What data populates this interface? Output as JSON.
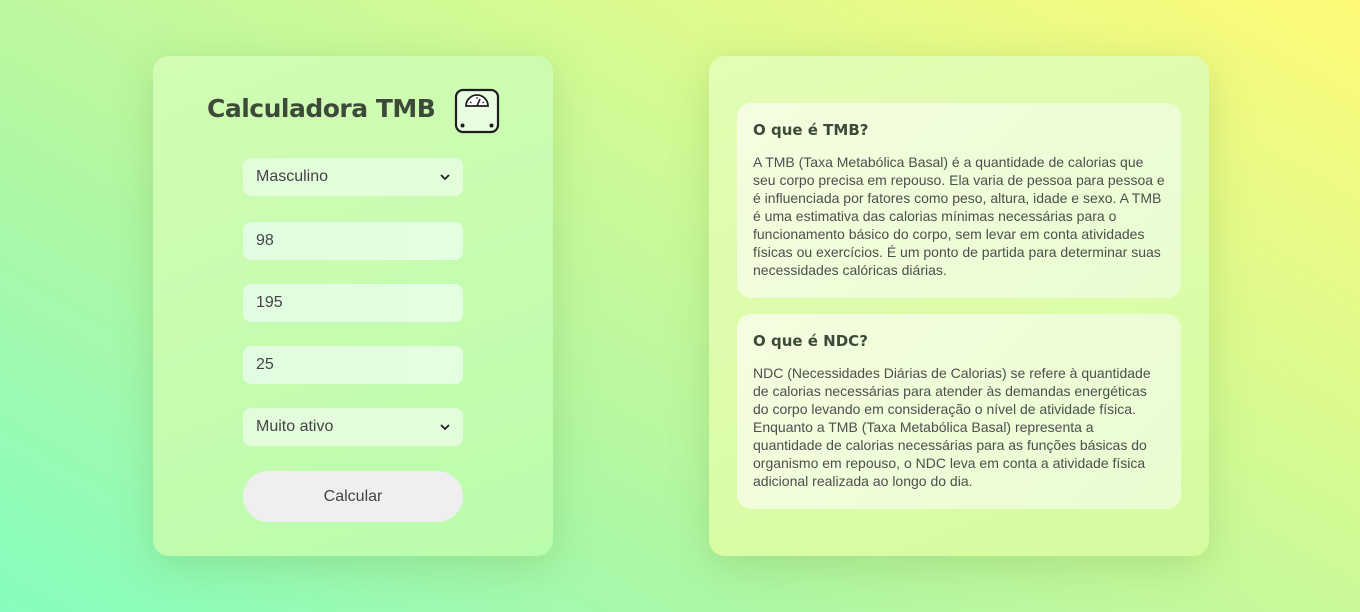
{
  "calculator": {
    "title": "Calculadora TMB",
    "sex_select": {
      "value": "Masculino",
      "options": [
        "Masculino"
      ]
    },
    "weight_value": "98",
    "height_value": "195",
    "age_value": "25",
    "activity_select": {
      "value": "Muito ativo",
      "options": [
        "Muito ativo"
      ]
    },
    "calc_button": "Calcular",
    "icon": "scale-icon"
  },
  "info": {
    "tmb": {
      "title": "O que é TMB?",
      "text": "A TMB (Taxa Metabólica Basal) é a quantidade de calorias que seu corpo precisa em repouso. Ela varia de pessoa para pessoa e é influenciada por fatores como peso, altura, idade e sexo. A TMB é uma estimativa das calorias mínimas necessárias para o funcionamento básico do corpo, sem levar em conta atividades físicas ou exercícios. É um ponto de partida para determinar suas necessidades calóricas diárias."
    },
    "ndc": {
      "title": "O que é NDC?",
      "text": "NDC (Necessidades Diárias de Calorias) se refere à quantidade de calorias necessárias para atender às demandas energéticas do corpo levando em consideração o nível de atividade física. Enquanto a TMB (Taxa Metabólica Basal) representa a quantidade de calorias necessárias para as funções básicas do organismo em repouso, o NDC leva em conta a atividade física adicional realizada ao longo do dia."
    }
  }
}
